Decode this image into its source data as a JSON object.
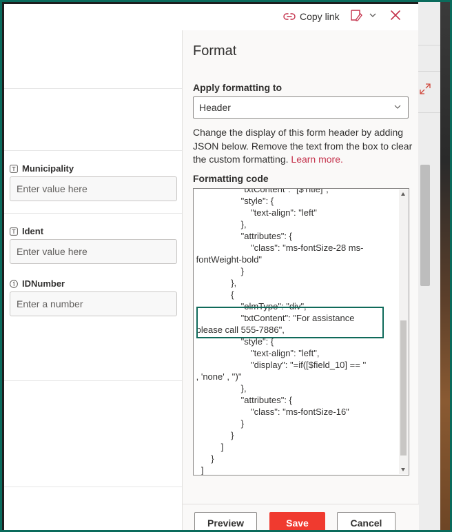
{
  "topbar": {
    "copy_link_label": "Copy link"
  },
  "form": {
    "fields": [
      {
        "label": "Municipality",
        "placeholder": "Enter value here",
        "type_icon": "text-field-icon"
      },
      {
        "label": "Ident",
        "placeholder": "Enter value here",
        "type_icon": "text-field-icon"
      },
      {
        "label": "IDNumber",
        "placeholder": "Enter a number",
        "type_icon": "number-field-icon"
      }
    ]
  },
  "format_panel": {
    "title": "Format",
    "apply_label": "Apply formatting to",
    "apply_value": "Header",
    "description": "Change the display of this form header by adding JSON below. Remove the text from the box to clear the custom formatting.",
    "learn_more": "Learn more.",
    "code_label": "Formatting code",
    "code_lines": [
      "                   \"txtContent\": \"[$Title]\",",
      "                   \"style\": {",
      "                       \"text-align\": \"left\"",
      "                   },",
      "                   \"attributes\": {",
      "                       \"class\": \"ms-fontSize-28 ms-",
      " fontWeight-bold\"",
      "                   }",
      "               },",
      "               {",
      "                   \"elmType\": \"div\",",
      "                   \"txtContent\": \"For assistance",
      " please call 555-7886\",",
      "                   \"style\": {",
      "                       \"text-align\": \"left\",",
      "                       \"display\": \"=if([$field_10] == ''",
      " , 'none' , '')\"",
      "                   },",
      "                   \"attributes\": {",
      "                       \"class\": \"ms-fontSize-16\"",
      "                   }",
      "               }",
      "           ]",
      "       }",
      "   ]"
    ],
    "buttons": {
      "preview": "Preview",
      "save": "Save",
      "cancel": "Cancel"
    }
  },
  "colors": {
    "accent_save": "#f03a2f",
    "highlight_border": "#0f6a5a",
    "learn_more_link": "#c4314b",
    "frame_border": "#0a6b5c"
  }
}
